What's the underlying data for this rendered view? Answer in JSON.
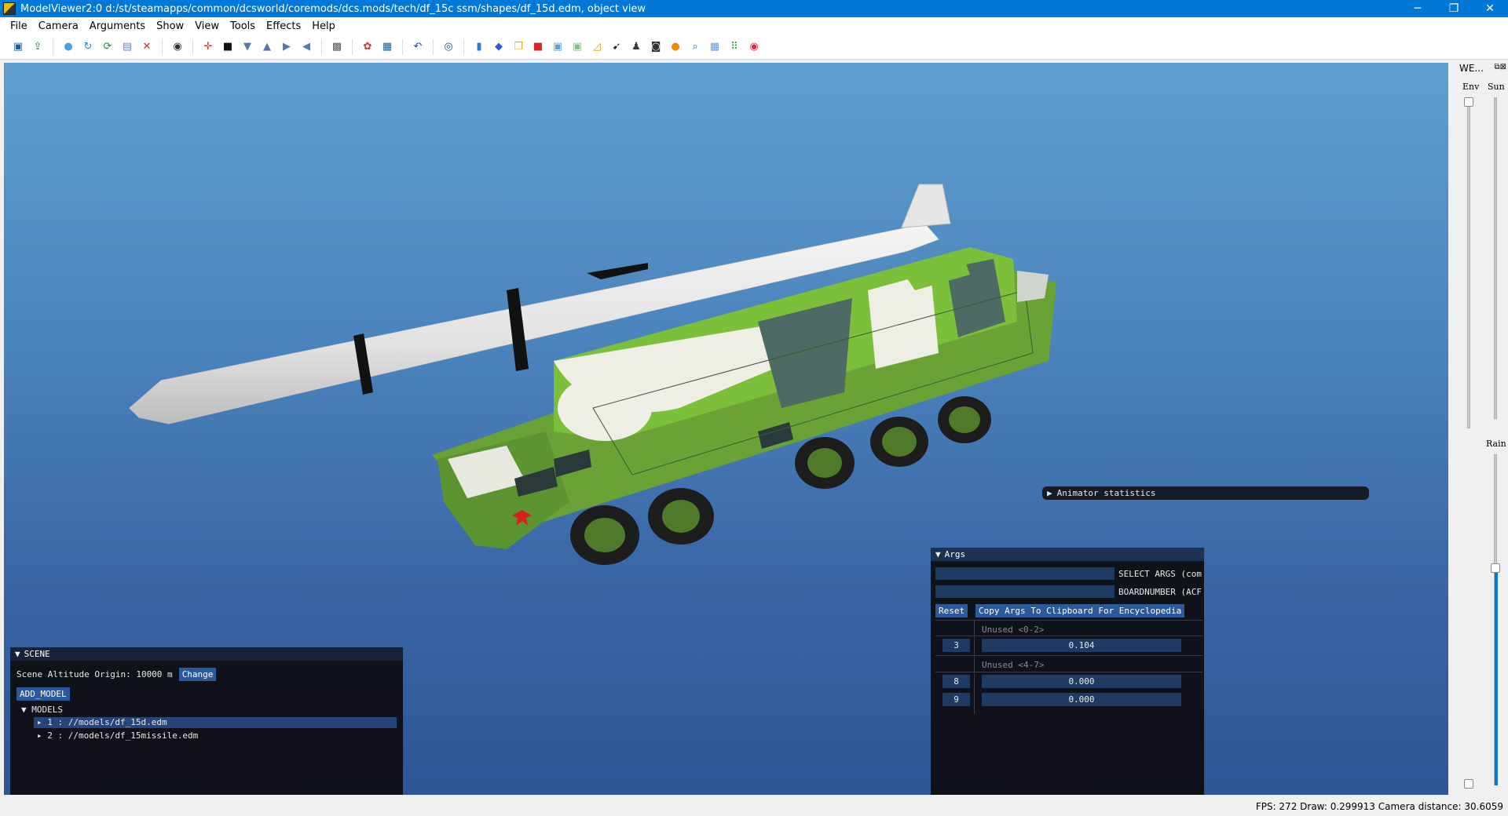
{
  "window": {
    "title": "ModelViewer2:0 d:/st/steamapps/common/dcsworld/coremods/dcs.mods/tech/df_15c ssm/shapes/df_15d.edm, object view",
    "minimize": "─",
    "restore": "❐",
    "close": "✕"
  },
  "menu": [
    "File",
    "Camera",
    "Arguments",
    "Show",
    "View",
    "Tools",
    "Effects",
    "Help"
  ],
  "toolbar_icons": [
    {
      "name": "save-icon",
      "glyph": "▣",
      "color": "#1f5fa8"
    },
    {
      "name": "export-icon",
      "glyph": "⇪",
      "color": "#2a7a2a"
    },
    {
      "name": "sep"
    },
    {
      "name": "sphere-icon",
      "glyph": "●",
      "color": "#4aa0e8"
    },
    {
      "name": "refresh-icon",
      "glyph": "↻",
      "color": "#2a88d8"
    },
    {
      "name": "reload-icon",
      "glyph": "⟳",
      "color": "#1e8a3a"
    },
    {
      "name": "texture-icon",
      "glyph": "▤",
      "color": "#6d88c0"
    },
    {
      "name": "pdf-icon",
      "glyph": "✕",
      "color": "#d22"
    },
    {
      "name": "sep"
    },
    {
      "name": "target-icon",
      "glyph": "◉",
      "color": "#333"
    },
    {
      "name": "sep"
    },
    {
      "name": "axis-icon",
      "glyph": "✛",
      "color": "#c33"
    },
    {
      "name": "bbox-icon",
      "glyph": "■",
      "color": "#111"
    },
    {
      "name": "funnel-icon",
      "glyph": "▼",
      "color": "#5577aa"
    },
    {
      "name": "cone-icon",
      "glyph": "▲",
      "color": "#5577aa"
    },
    {
      "name": "arrow-right-icon",
      "glyph": "▶",
      "color": "#5577aa"
    },
    {
      "name": "arrow-left-icon",
      "glyph": "◀",
      "color": "#5577aa"
    },
    {
      "name": "sep"
    },
    {
      "name": "photo-icon",
      "glyph": "▩",
      "color": "#555"
    },
    {
      "name": "sep"
    },
    {
      "name": "palette-icon",
      "glyph": "✿",
      "color": "#c33"
    },
    {
      "name": "film-icon",
      "glyph": "▦",
      "color": "#1b5a8a"
    },
    {
      "name": "sep"
    },
    {
      "name": "undo-icon",
      "glyph": "↶",
      "color": "#2244aa"
    },
    {
      "name": "sep"
    },
    {
      "name": "camera-icon",
      "glyph": "◎",
      "color": "#115577"
    },
    {
      "name": "sep"
    },
    {
      "name": "chart-icon",
      "glyph": "▮",
      "color": "#2a7ad8"
    },
    {
      "name": "cube-icon",
      "glyph": "◆",
      "color": "#2a5ad8"
    },
    {
      "name": "copy-icon",
      "glyph": "❐",
      "color": "#e8a800"
    },
    {
      "name": "red-cube-icon",
      "glyph": "■",
      "color": "#d22"
    },
    {
      "name": "box-icon",
      "glyph": "▣",
      "color": "#5aa0e0"
    },
    {
      "name": "green-box-icon",
      "glyph": "▣",
      "color": "#88c088"
    },
    {
      "name": "graph-icon",
      "glyph": "◿",
      "color": "#e8a000"
    },
    {
      "name": "cursor-icon",
      "glyph": "➹",
      "color": "#222"
    },
    {
      "name": "person-icon",
      "glyph": "♟",
      "color": "#3a3a3a"
    },
    {
      "name": "car-icon",
      "glyph": "◙",
      "color": "#333"
    },
    {
      "name": "sun-icon",
      "glyph": "●",
      "color": "#f08a00"
    },
    {
      "name": "zoom-icon",
      "glyph": "⌕",
      "color": "#2266aa"
    },
    {
      "name": "grid-icon",
      "glyph": "▦",
      "color": "#6a9ad8"
    },
    {
      "name": "dots-grid-icon",
      "glyph": "⠿",
      "color": "#2a9a2a"
    },
    {
      "name": "record-icon",
      "glyph": "◉",
      "color": "#e24"
    }
  ],
  "weather": {
    "title": "WE...",
    "env_label": "Env",
    "sun_label": "Sun",
    "rain_label": "Rain",
    "float_btn": "⧉",
    "close_btn": "⊠",
    "env_level": 1.0,
    "sun_level": 0.0,
    "rain_level": 0.66
  },
  "scene": {
    "header": "SCENE",
    "altitude_label": "Scene Altitude Origin: 10000 m",
    "change_button": "Change",
    "add_model_button": "ADD_MODEL",
    "models_header": "MODELS",
    "models": [
      "1 : //models/df_15d.edm",
      "2 : //models/df_15missile.edm"
    ]
  },
  "animator": {
    "label": "Animator statistics"
  },
  "args": {
    "header": "Args",
    "select_label": "SELECT ARGS (com",
    "boardnumber_label": "BOARDNUMBER (ACF",
    "reset_button": "Reset",
    "copy_button": "Copy Args To Clipboard For Encyclopedia",
    "unused_0_2": "Unused <0-2>",
    "unused_4_7": "Unused <4-7>",
    "rows": [
      {
        "index": "3",
        "value": "0.104"
      },
      {
        "index": "8",
        "value": "0.000"
      },
      {
        "index": "9",
        "value": "0.000"
      }
    ]
  },
  "status": {
    "text": "FPS: 272  Draw: 0.299913  Camera distance: 30.6059"
  }
}
